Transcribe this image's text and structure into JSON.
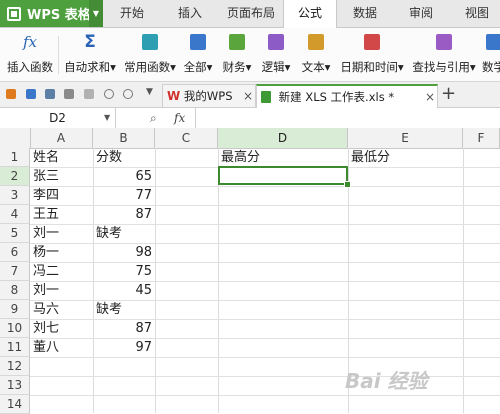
{
  "app": {
    "brand": "WPS 表格"
  },
  "menu": {
    "tabs": [
      "开始",
      "插入",
      "页面布局",
      "公式",
      "数据",
      "审阅",
      "视图"
    ],
    "active_tab": "公式"
  },
  "ribbon": {
    "buttons": [
      {
        "label": "插入函数",
        "icon": "fx-icon"
      },
      {
        "label": "自动求和",
        "icon": "sigma-icon"
      },
      {
        "label": "常用函数",
        "icon": "star-book-icon"
      },
      {
        "label": "全部",
        "icon": "book-icon"
      },
      {
        "label": "财务",
        "icon": "finance-book-icon"
      },
      {
        "label": "逻辑",
        "icon": "logic-book-icon"
      },
      {
        "label": "文本",
        "icon": "text-book-icon"
      },
      {
        "label": "日期和时间",
        "icon": "clock-book-icon"
      },
      {
        "label": "查找与引用",
        "icon": "search-book-icon"
      },
      {
        "label": "数学",
        "icon": "math-book-icon"
      }
    ]
  },
  "doc_tabs": [
    {
      "label": "我的WPS",
      "active": false
    },
    {
      "label": "新建 XLS 工作表.xls *",
      "active": true
    }
  ],
  "formula_bar": {
    "name_box": "D2",
    "fx_label": "fx",
    "value": ""
  },
  "sheet": {
    "columns": [
      "A",
      "B",
      "C",
      "D",
      "E",
      "F"
    ],
    "selected_column": "D",
    "rows": [
      "1",
      "2",
      "3",
      "4",
      "5",
      "6",
      "7",
      "8",
      "9",
      "10",
      "11",
      "12",
      "13",
      "14"
    ],
    "selected_row": "2",
    "cells": {
      "A1": "姓名",
      "B1": "分数",
      "D1": "最高分",
      "E1": "最低分",
      "A2": "张三",
      "B2": "65",
      "A3": "李四",
      "B3": "77",
      "A4": "王五",
      "B4": "87",
      "A5": "刘一",
      "B5": "缺考",
      "A6": "杨一",
      "B6": "98",
      "A7": "冯二",
      "B7": "75",
      "A8": "刘一",
      "B8": "45",
      "A9": "马六",
      "B9": "缺考",
      "A10": "刘七",
      "B10": "87",
      "A11": "董八",
      "B11": "97"
    }
  },
  "watermark": "Bai 经验",
  "colors": {
    "brand_green": "#4e9f3d",
    "selection_green": "#3b8a2e",
    "header_highlight": "#d9ecd5"
  }
}
